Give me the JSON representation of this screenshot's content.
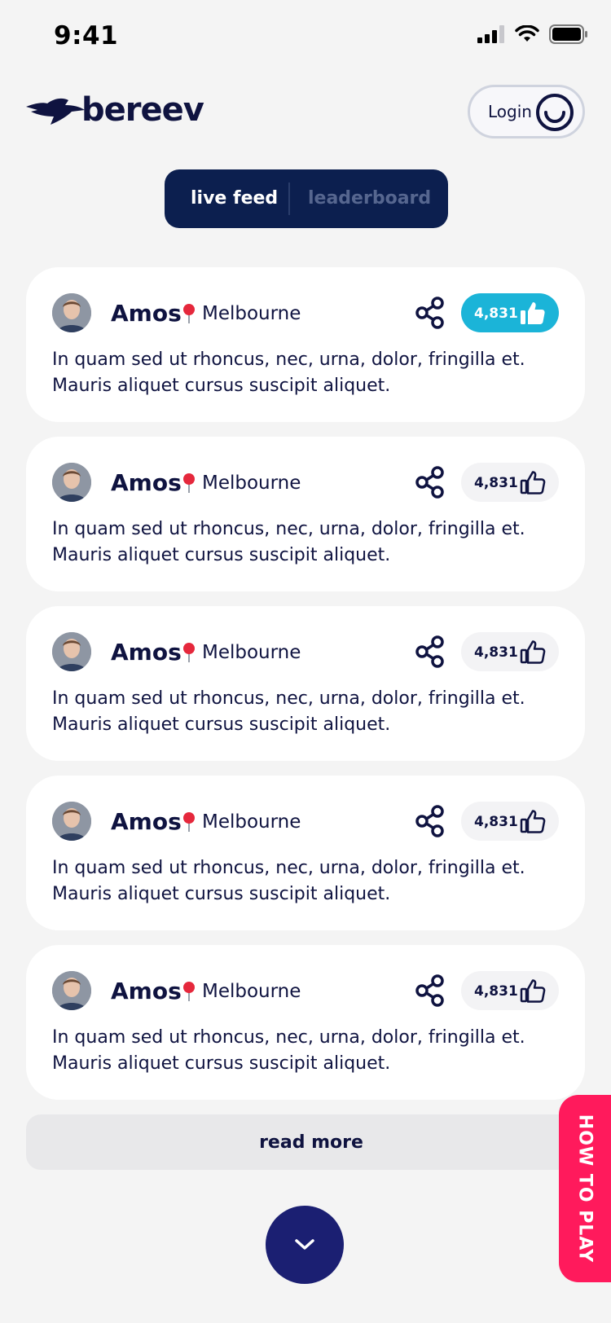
{
  "status_bar": {
    "time": "9:41"
  },
  "header": {
    "logo_text": "bereev",
    "login_label": "Login"
  },
  "tabs": [
    {
      "label": "live feed",
      "active": true
    },
    {
      "label": "leaderboard",
      "active": false
    }
  ],
  "feed": [
    {
      "name": "Amos",
      "location": "Melbourne",
      "likes": "4,831",
      "liked": true,
      "text": "In quam sed ut rhoncus, nec, urna, dolor, fringilla et. Mauris aliquet cursus suscipit aliquet."
    },
    {
      "name": "Amos",
      "location": "Melbourne",
      "likes": "4,831",
      "liked": false,
      "text": "In quam sed ut rhoncus, nec, urna, dolor, fringilla et. Mauris aliquet cursus suscipit aliquet."
    },
    {
      "name": "Amos",
      "location": "Melbourne",
      "likes": "4,831",
      "liked": false,
      "text": "In quam sed ut rhoncus, nec, urna, dolor, fringilla et. Mauris aliquet cursus suscipit aliquet."
    },
    {
      "name": "Amos",
      "location": "Melbourne",
      "likes": "4,831",
      "liked": false,
      "text": "In quam sed ut rhoncus, nec, urna, dolor, fringilla et. Mauris aliquet cursus suscipit aliquet."
    },
    {
      "name": "Amos",
      "location": "Melbourne",
      "likes": "4,831",
      "liked": false,
      "text": "In quam sed ut rhoncus, nec, urna, dolor, fringilla et. Mauris aliquet cursus suscipit aliquet."
    }
  ],
  "read_more_label": "read more",
  "how_to_play_label": "HOW TO PLAY",
  "icons": {
    "location": "pin-icon",
    "share": "share-icon",
    "like": "thumbs-up-icon",
    "scroll": "chevron-down-icon",
    "login": "smiley-icon"
  },
  "colors": {
    "navy": "#0f1340",
    "tab_bg": "#0c1f4f",
    "like_active": "#1bb4d8",
    "how_to_play": "#ff1a5c",
    "scroll_button": "#1b1f72"
  }
}
